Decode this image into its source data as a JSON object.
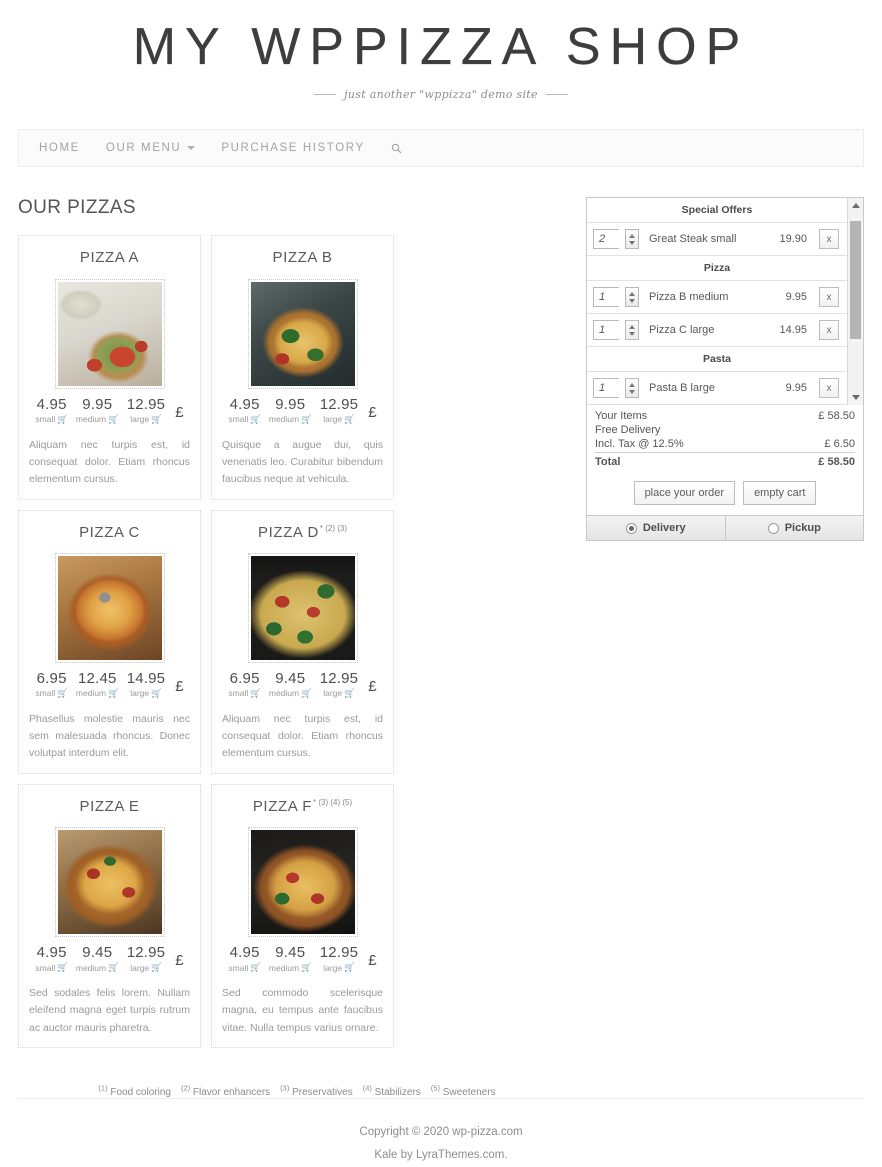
{
  "header": {
    "site_title": "MY WPPIZZA SHOP",
    "tagline": "just another \"wppizza\" demo site"
  },
  "nav": {
    "items": [
      {
        "label": "HOME",
        "has_caret": false
      },
      {
        "label": "OUR MENU",
        "has_caret": true
      },
      {
        "label": "PURCHASE HISTORY",
        "has_caret": false
      }
    ],
    "search_icon": "search-icon"
  },
  "main": {
    "section_title": "OUR PIZZAS",
    "currency_symbol": "£",
    "size_labels": {
      "small": "small",
      "medium": "medium",
      "large": "large"
    },
    "cart_icon": "cart-icon",
    "pizzas": [
      {
        "name": "PIZZA A",
        "superscripts": "",
        "image": "img-a",
        "prices": {
          "small": "4.95",
          "medium": "9.95",
          "large": "12.95"
        },
        "description": "Aliquam nec turpis est, id consequat dolor. Etiam rhoncus elementum cursus."
      },
      {
        "name": "PIZZA B",
        "superscripts": "",
        "image": "img-b",
        "prices": {
          "small": "4.95",
          "medium": "9.95",
          "large": "12.95"
        },
        "description": "Quisque a augue dui, quis venenatis leo. Curabitur bibendum faucibus neque at vehicula."
      },
      {
        "name": "PIZZA C",
        "superscripts": "",
        "image": "img-c",
        "prices": {
          "small": "6.95",
          "medium": "12.45",
          "large": "14.95"
        },
        "description": "Phasellus molestie mauris nec sem malesuada rhoncus. Donec volutpat interdum elit."
      },
      {
        "name": "PIZZA D",
        "superscripts": "* (2) (3)",
        "image": "img-d",
        "prices": {
          "small": "6.95",
          "medium": "9.45",
          "large": "12.95"
        },
        "description": "Aliquam nec turpis est, id consequat dolor. Etiam rhoncus elementum cursus."
      },
      {
        "name": "PIZZA E",
        "superscripts": "",
        "image": "img-e",
        "prices": {
          "small": "4.95",
          "medium": "9.45",
          "large": "12.95"
        },
        "description": "Sed sodales felis lorem. Nullam eleifend magna eget turpis rutrum ac auctor mauris pharetra."
      },
      {
        "name": "PIZZA F",
        "superscripts": "* (3) (4) (5)",
        "image": "img-f",
        "prices": {
          "small": "4.95",
          "medium": "9.45",
          "large": "12.95"
        },
        "description": "Sed commodo scelerisque magna, eu tempus ante faucibus vitae. Nulla tempus varius ornare."
      }
    ],
    "footnotes": [
      {
        "marker": "(1)",
        "text": "Food coloring"
      },
      {
        "marker": "(2)",
        "text": "Flavor enhancers"
      },
      {
        "marker": "(3)",
        "text": "Preservatives"
      },
      {
        "marker": "(4)",
        "text": "Stabilizers"
      },
      {
        "marker": "(5)",
        "text": "Sweeteners"
      }
    ]
  },
  "cart": {
    "groups": [
      {
        "heading": "Special Offers",
        "items": [
          {
            "qty": "2",
            "name": "Great Steak small",
            "price": "19.90",
            "remove": "x"
          }
        ]
      },
      {
        "heading": "Pizza",
        "items": [
          {
            "qty": "1",
            "name": "Pizza B medium",
            "price": "9.95",
            "remove": "x"
          },
          {
            "qty": "1",
            "name": "Pizza C large",
            "price": "14.95",
            "remove": "x"
          }
        ]
      },
      {
        "heading": "Pasta",
        "items": [
          {
            "qty": "1",
            "name": "Pasta B large",
            "price": "9.95",
            "remove": "x"
          }
        ]
      }
    ],
    "totals": [
      {
        "label": "Your Items",
        "value": "£ 58.50"
      },
      {
        "label": "Free Delivery",
        "value": ""
      },
      {
        "label": "Incl. Tax @ 12.5%",
        "value": "£ 6.50"
      },
      {
        "label": "Total",
        "value": "£ 58.50"
      }
    ],
    "place_order_label": "place your order",
    "empty_cart_label": "empty cart",
    "delivery_label": "Delivery",
    "pickup_label": "Pickup",
    "delivery_selected": true
  },
  "footer": {
    "copyright": "Copyright © 2020 wp-pizza.com",
    "credit": "Kale by LyraThemes.com."
  }
}
